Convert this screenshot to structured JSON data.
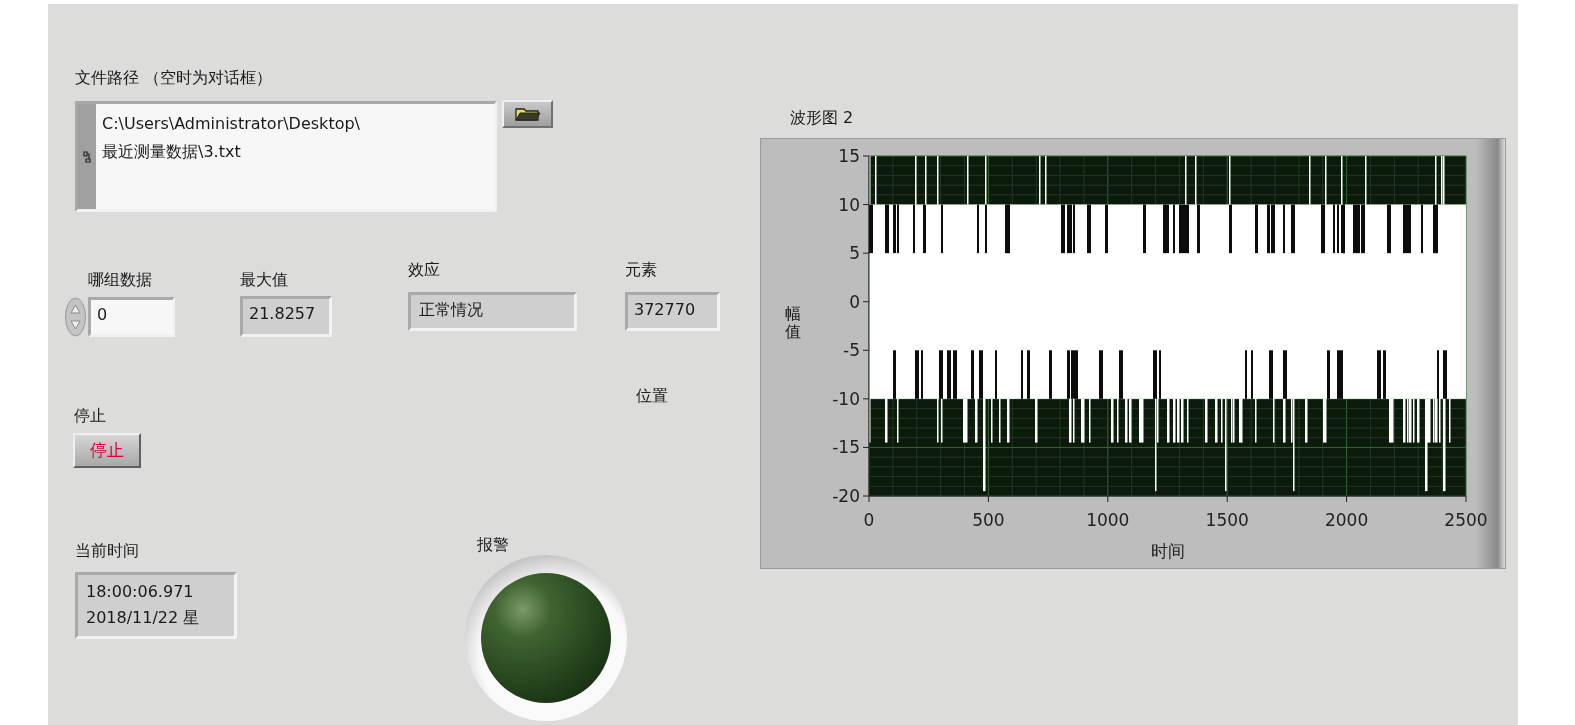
{
  "path_control": {
    "label": "文件路径 （空时为对话框）",
    "value_lines": [
      "C:\\Users\\Administrator\\Desktop\\",
      "最近测量数据\\3.txt"
    ]
  },
  "group_control": {
    "label": "哪组数据",
    "value": "0"
  },
  "max_indicator": {
    "label": "最大值",
    "value": "21.8257"
  },
  "effect_indicator": {
    "label": "效应",
    "value": "正常情况"
  },
  "element_indicator": {
    "label": "元素",
    "value": "372770"
  },
  "position_label": "位置",
  "stop_control": {
    "label": "停止",
    "text": "停止",
    "pressed": false
  },
  "time_indicator": {
    "label": "当前时间",
    "value_lines": [
      "18:00:06.971",
      "2018/11/22 星"
    ]
  },
  "alarm_led": {
    "label": "报警",
    "on": false
  },
  "graph": {
    "label": "波形图 2",
    "x_label": "时间",
    "y_label": "幅值",
    "x_ticks": [
      "0",
      "500",
      "1000",
      "1500",
      "2000",
      "2500"
    ],
    "y_ticks": [
      "15",
      "10",
      "5",
      "0",
      "-5",
      "-10",
      "-15",
      "-20"
    ]
  }
}
